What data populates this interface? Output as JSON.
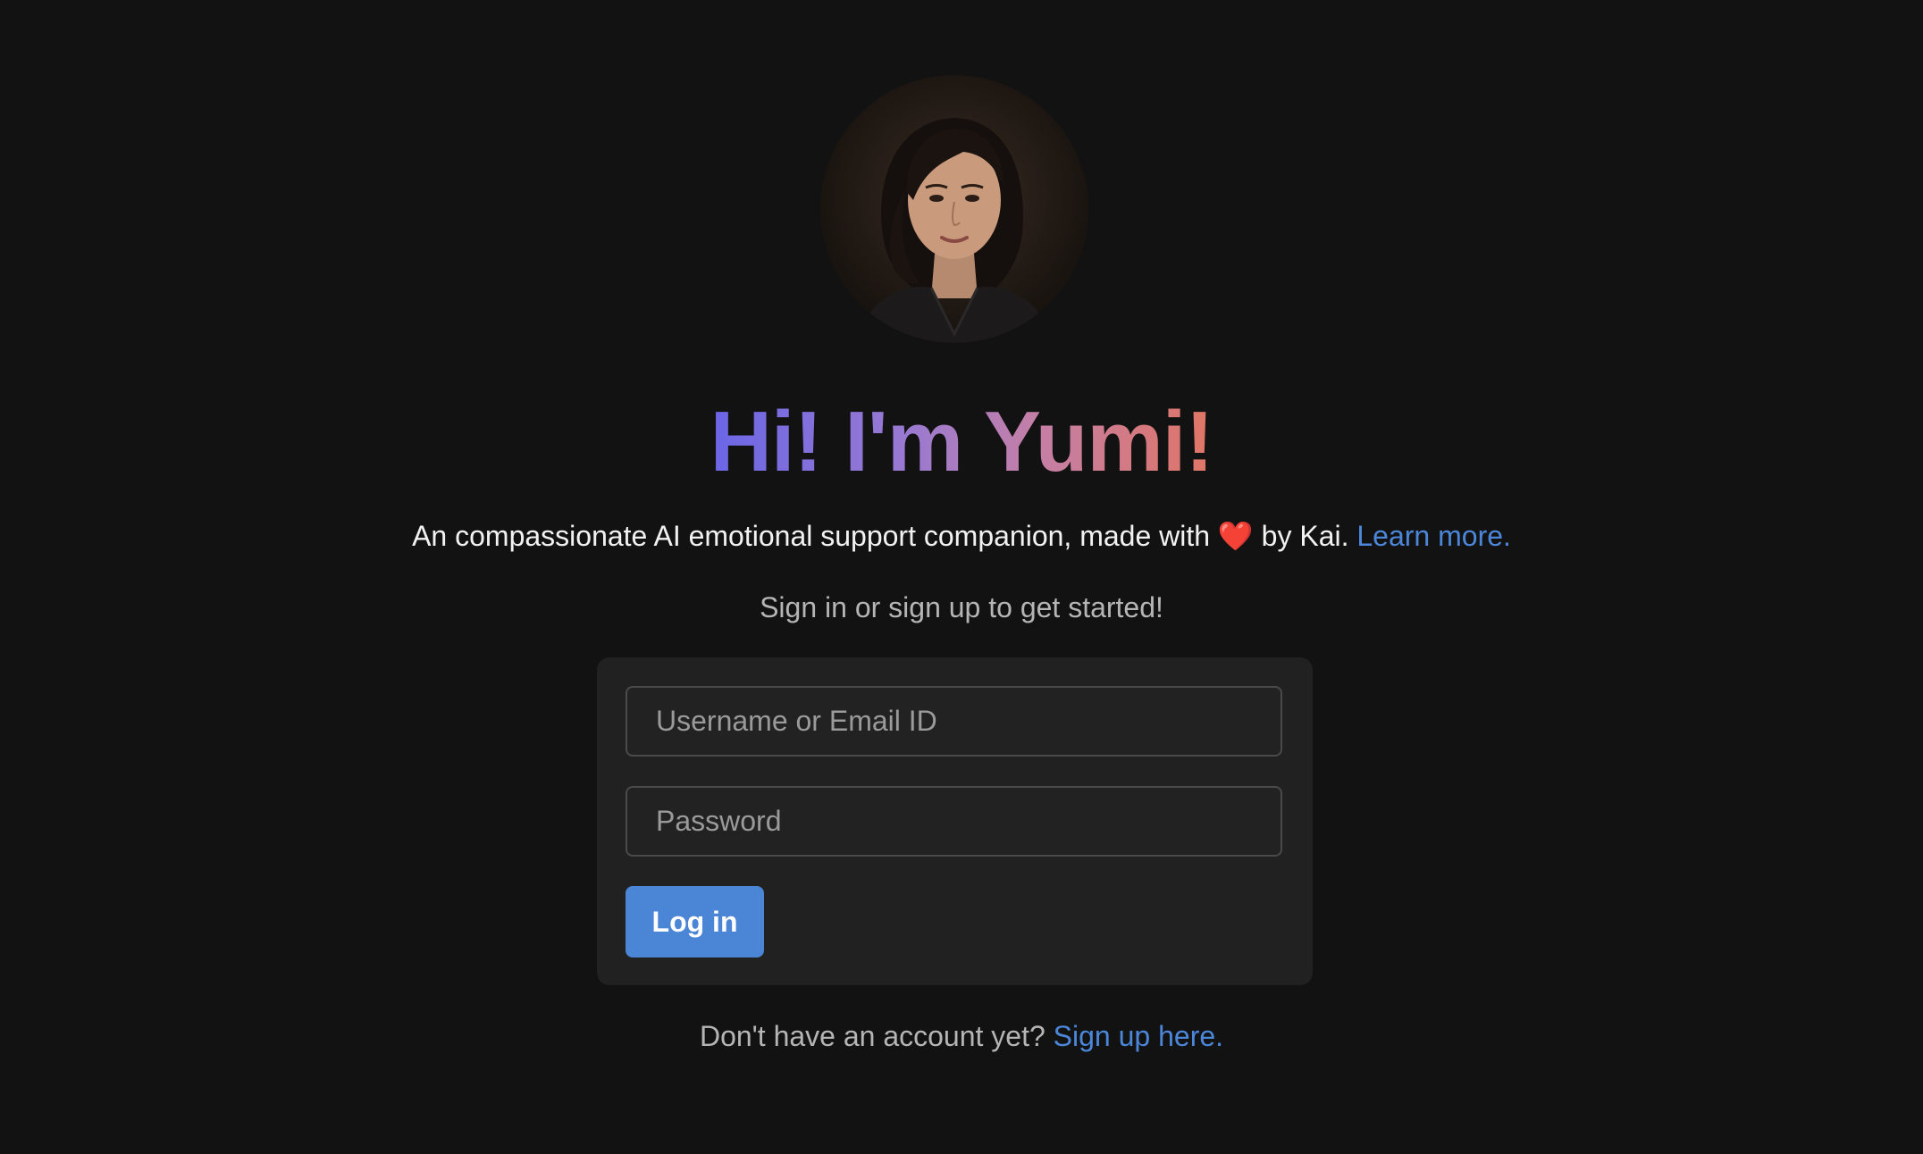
{
  "profile": {
    "avatar_alt": "Yumi portrait"
  },
  "headline": "Hi! I'm Yumi!",
  "tagline": {
    "before": "An compassionate AI emotional support companion, made with ",
    "heart": "❤️",
    "after": " by Kai. ",
    "learn_more": "Learn more."
  },
  "subtitle": "Sign in or sign up to get started!",
  "login_form": {
    "username_placeholder": "Username or Email ID",
    "username_value": "",
    "password_placeholder": "Password",
    "password_value": "",
    "login_label": "Log in"
  },
  "signup": {
    "prompt": "Don't have an account yet? ",
    "link": "Sign up here."
  },
  "colors": {
    "background": "#121212",
    "card": "#212121",
    "accent": "#4a85d6",
    "heading_gradient_start": "#6b66e6",
    "heading_gradient_end": "#e07565"
  },
  "icons": {
    "heart": "heart-icon"
  }
}
